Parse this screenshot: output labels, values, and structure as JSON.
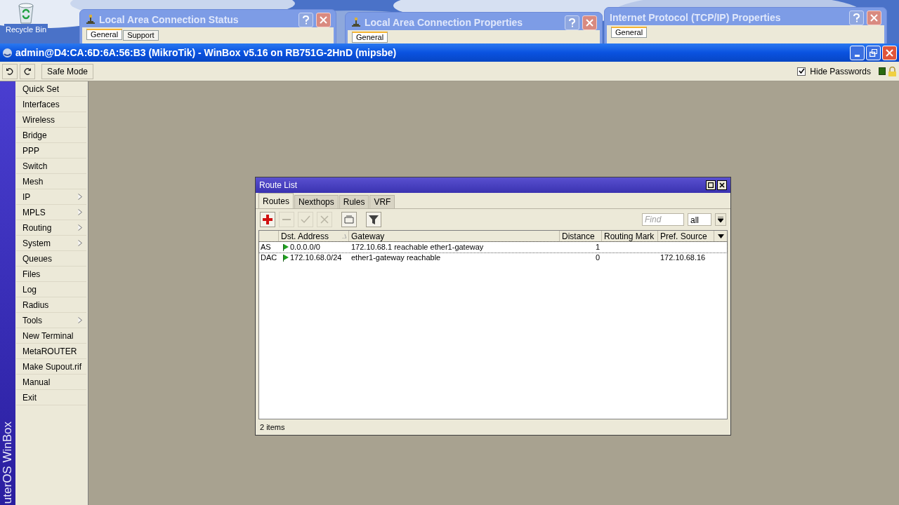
{
  "desktop": {
    "icons": [
      {
        "label": "Recycle Bin"
      }
    ],
    "windows": [
      {
        "title": "Local Area Connection Status",
        "tabs": [
          {
            "label": "General",
            "selected": true
          },
          {
            "label": "Support",
            "selected": false
          }
        ]
      },
      {
        "title": "Local Area Connection Properties",
        "tabs": [
          {
            "label": "General",
            "selected": true
          }
        ]
      },
      {
        "title": "Internet Protocol (TCP/IP) Properties",
        "tabs": [
          {
            "label": "General",
            "selected": true
          }
        ]
      }
    ]
  },
  "window": {
    "title": "admin@D4:CA:6D:6A:56:B3 (MikroTik) - WinBox v5.16 on RB751G-2HnD (mipsbe)"
  },
  "toolbar": {
    "safe_mode": "Safe Mode",
    "hide_passwords": {
      "label": "Hide Passwords",
      "checked": true
    }
  },
  "sidebar": {
    "brand": "uterOS WinBox",
    "items": [
      {
        "label": "Quick Set",
        "submenu": false
      },
      {
        "label": "Interfaces",
        "submenu": false
      },
      {
        "label": "Wireless",
        "submenu": false
      },
      {
        "label": "Bridge",
        "submenu": false
      },
      {
        "label": "PPP",
        "submenu": false
      },
      {
        "label": "Switch",
        "submenu": false
      },
      {
        "label": "Mesh",
        "submenu": false
      },
      {
        "label": "IP",
        "submenu": true
      },
      {
        "label": "MPLS",
        "submenu": true
      },
      {
        "label": "Routing",
        "submenu": true
      },
      {
        "label": "System",
        "submenu": true
      },
      {
        "label": "Queues",
        "submenu": false
      },
      {
        "label": "Files",
        "submenu": false
      },
      {
        "label": "Log",
        "submenu": false
      },
      {
        "label": "Radius",
        "submenu": false
      },
      {
        "label": "Tools",
        "submenu": true
      },
      {
        "label": "New Terminal",
        "submenu": false
      },
      {
        "label": "MetaROUTER",
        "submenu": false
      },
      {
        "label": "Make Supout.rif",
        "submenu": false
      },
      {
        "label": "Manual",
        "submenu": false
      },
      {
        "label": "Exit",
        "submenu": false
      }
    ]
  },
  "route_list": {
    "title": "Route List",
    "tabs": [
      {
        "label": "Routes",
        "selected": true
      },
      {
        "label": "Nexthops",
        "selected": false
      },
      {
        "label": "Rules",
        "selected": false
      },
      {
        "label": "VRF",
        "selected": false
      }
    ],
    "tools": [
      {
        "kind": "add",
        "disabled": false
      },
      {
        "kind": "remove",
        "disabled": true
      },
      {
        "kind": "enable",
        "disabled": true
      },
      {
        "kind": "disable",
        "disabled": true
      },
      {
        "kind": "comment",
        "disabled": false
      },
      {
        "kind": "filter",
        "disabled": false
      }
    ],
    "find": {
      "placeholder": "Find"
    },
    "filter": "all",
    "columns": [
      {
        "label": "Dst. Address",
        "sorted": true
      },
      {
        "label": "Gateway",
        "sorted": false
      },
      {
        "label": "Distance",
        "sorted": false
      },
      {
        "label": "Routing Mark",
        "sorted": false
      },
      {
        "label": "Pref. Source",
        "sorted": false
      }
    ],
    "rows": [
      {
        "flags": "AS",
        "active": true,
        "selected": true,
        "dst": "0.0.0.0/0",
        "gateway": "172.10.68.1 reachable ether1-gateway",
        "distance": "1"
      },
      {
        "flags": "DAC",
        "active": true,
        "selected": false,
        "dst": "172.10.68.0/24",
        "gateway": "ether1-gateway reachable",
        "distance": "0",
        "pref_source": "172.10.68.16"
      }
    ],
    "status": "2 items"
  }
}
